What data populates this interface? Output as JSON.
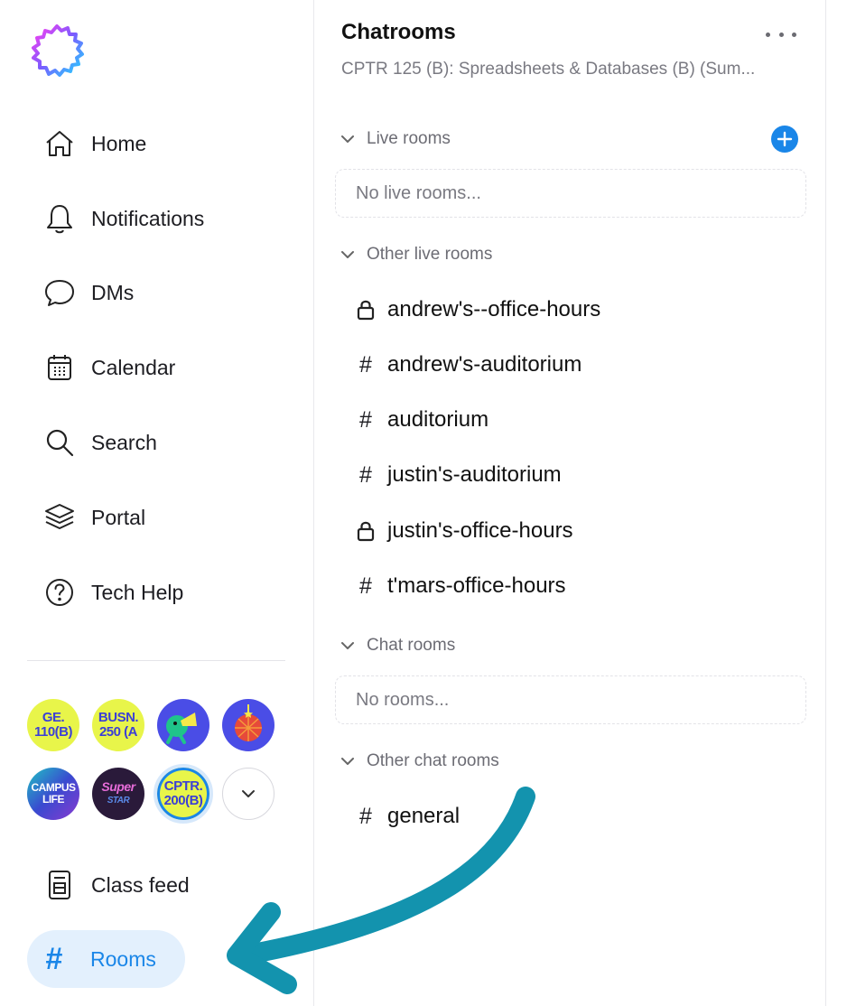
{
  "sidebar": {
    "logo_icon": "app-logo-icon",
    "nav": [
      {
        "label": "Home",
        "icon": "home-icon"
      },
      {
        "label": "Notifications",
        "icon": "bell-icon"
      },
      {
        "label": "DMs",
        "icon": "chat-bubble-icon"
      },
      {
        "label": "Calendar",
        "icon": "calendar-icon"
      },
      {
        "label": "Search",
        "icon": "search-icon"
      },
      {
        "label": "Portal",
        "icon": "layers-icon"
      },
      {
        "label": "Tech Help",
        "icon": "help-icon"
      }
    ],
    "courses": [
      {
        "line1": "GE.",
        "line2": "110(B)",
        "bg": "#e8f54a",
        "fg": "#3b3fd6"
      },
      {
        "line1": "BUSN.",
        "line2": "250 (A",
        "bg": "#e8f54a",
        "fg": "#3b3fd6"
      },
      {
        "line1": "",
        "line2": "",
        "bg": "#4a4de6",
        "fg": "#ffffff",
        "icon": "megaphone-character-icon"
      },
      {
        "line1": "",
        "line2": "",
        "bg": "#4a4de6",
        "fg": "#ffffff",
        "icon": "disco-ball-icon"
      },
      {
        "line1": "CAMPUS",
        "line2": "LIFE",
        "bg": "#3a7fd0",
        "fg": "#ffffff"
      },
      {
        "line1": "Super",
        "line2": "STAR",
        "bg": "#2a1a3a",
        "fg": "#e66cd8"
      },
      {
        "line1": "CPTR.",
        "line2": "200(B)",
        "bg": "#e8f54a",
        "fg": "#3b3fd6"
      }
    ],
    "more_icon": "chevron-down-icon",
    "class_feed": {
      "label": "Class feed",
      "icon": "document-icon"
    },
    "rooms": {
      "label": "Rooms",
      "icon": "hash-icon"
    }
  },
  "main": {
    "title": "Chatrooms",
    "subtitle": "CPTR 125 (B): Spreadsheets & Databases (B) (Sum...",
    "more_icon": "more-dots-icon",
    "sections": {
      "live": {
        "label": "Live rooms",
        "empty": "No live rooms..."
      },
      "other_live": {
        "label": "Other live rooms"
      },
      "chat": {
        "label": "Chat rooms",
        "empty": "No rooms..."
      },
      "other_chat": {
        "label": "Other chat rooms"
      }
    },
    "other_live_rooms": [
      {
        "name": "andrew's--office-hours",
        "icon": "lock-icon"
      },
      {
        "name": "andrew's-auditorium",
        "icon": "hash-icon"
      },
      {
        "name": "auditorium",
        "icon": "hash-icon"
      },
      {
        "name": "justin's-auditorium",
        "icon": "hash-icon"
      },
      {
        "name": "justin's-office-hours",
        "icon": "lock-icon"
      },
      {
        "name": "t'mars-office-hours",
        "icon": "hash-icon"
      }
    ],
    "other_chat_rooms": [
      {
        "name": "general",
        "icon": "hash-icon"
      }
    ],
    "hash_glyph": "#"
  },
  "colors": {
    "accent": "#1a86e8",
    "accent_bg": "#e3f0fd",
    "annotation_arrow": "#1393ae"
  }
}
